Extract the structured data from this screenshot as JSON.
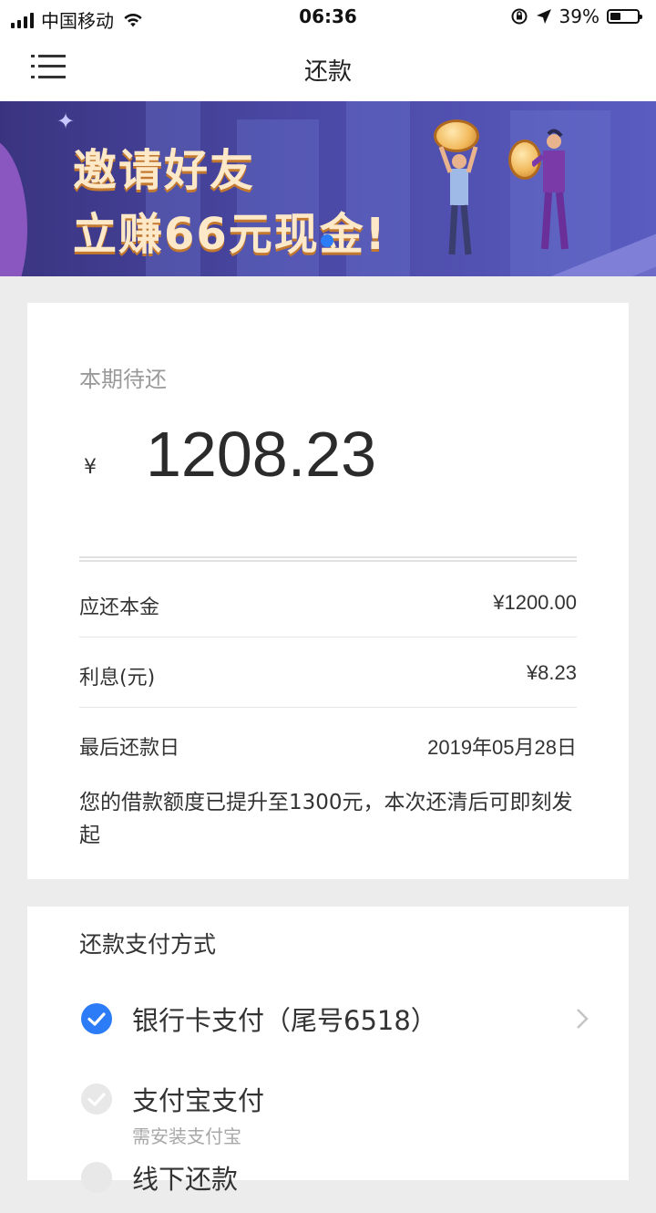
{
  "status_bar": {
    "carrier": "中国移动",
    "time": "06:36",
    "battery": "39%",
    "icons": [
      "signal-icon",
      "wifi-icon",
      "orientation-lock-icon",
      "location-icon",
      "battery-icon"
    ]
  },
  "nav": {
    "title": "还款",
    "menu_icon": "menu-icon"
  },
  "banner": {
    "line1": "邀请好友",
    "line2": "立赚66元现金!"
  },
  "repayment": {
    "due_label": "本期待还",
    "currency": "¥",
    "amount": "1208.23",
    "rows": [
      {
        "label": "应还本金",
        "value": "¥1200.00"
      },
      {
        "label": "利息(元)",
        "value": "¥8.23"
      },
      {
        "label": "最后还款日",
        "value": "2019年05月28日"
      }
    ],
    "notice": "您的借款额度已提升至1300元，本次还清后可即刻发起"
  },
  "payment": {
    "title": "还款支付方式",
    "options": [
      {
        "label": "银行卡支付（尾号6518）",
        "sub": "",
        "selected": true
      },
      {
        "label": "支付宝支付",
        "sub": "需安装支付宝",
        "selected": false
      },
      {
        "label": "线下还款",
        "sub": "",
        "selected": false
      }
    ]
  },
  "colors": {
    "accent": "#2b7cf6",
    "background": "#ececec",
    "banner_bg": "#4a48a4"
  }
}
